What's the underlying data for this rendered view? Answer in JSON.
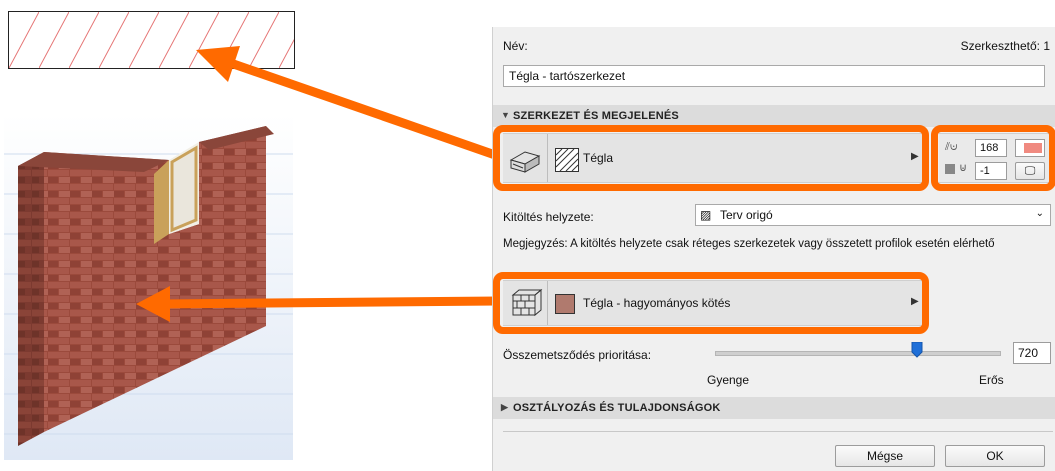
{
  "dialog": {
    "name_label": "Név:",
    "editable_label": "Szerkeszthető: 1",
    "name_value": "Tégla - tartószerkezet",
    "section_structure": "SZERKEZET ÉS MEGJELENÉS",
    "structure_material": "Tégla",
    "pen_value": "168",
    "bg_pen_value": "-1",
    "fill_position_label": "Kitöltés helyzete:",
    "fill_position_value": "Terv origó",
    "note": "Megjegyzés: A kitöltés helyzete csak réteges szerkezetek vagy összetett profilok esetén elérhető",
    "surface_material": "Tégla - hagyományos kötés",
    "priority_label": "Összemetsződés prioritása:",
    "priority_value": "720",
    "priority_fraction": 0.72,
    "slider_min_label": "Gyenge",
    "slider_max_label": "Erős",
    "section_classification": "OSZTÁLYOZÁS ÉS TULAJDONSÁGOK",
    "cancel_label": "Mégse",
    "ok_label": "OK"
  },
  "colors": {
    "highlight": "#ff6a00",
    "brick": "#b07a6e",
    "pen_swatch": "#f08a80"
  },
  "icons": [
    "hatch-fill-icon",
    "cut-surface-icon",
    "pen-icon",
    "brick-wall-icon",
    "screen-icon",
    "chevron-right-icon",
    "chevron-down-icon"
  ]
}
